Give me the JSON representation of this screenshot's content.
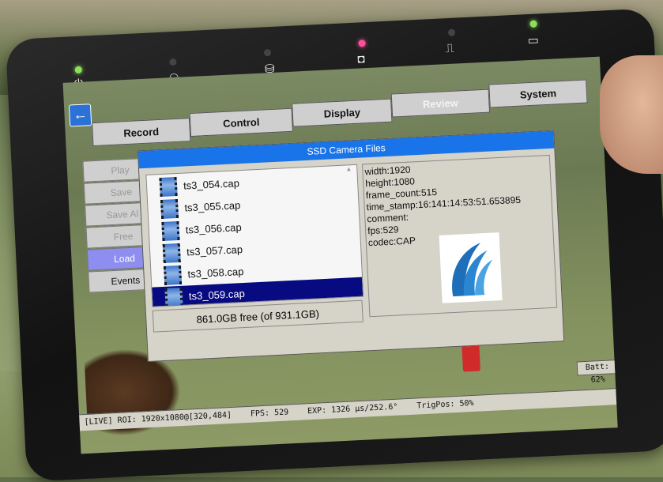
{
  "top_icons": {
    "power": "⏻",
    "network": "⚇",
    "storage": "⛁",
    "camera": "◘",
    "trigger": "⎍",
    "battery": "▭"
  },
  "tabs": [
    "Record",
    "Control",
    "Display",
    "Review",
    "System"
  ],
  "side_buttons": [
    "Play",
    "Save",
    "Save Al",
    "Free",
    "Load",
    "Events"
  ],
  "dialog": {
    "title": "SSD Camera Files",
    "files": [
      "ts3_054.cap",
      "ts3_055.cap",
      "ts3_056.cap",
      "ts3_057.cap",
      "ts3_058.cap",
      "ts3_059.cap"
    ],
    "selected_file": "ts3_059.cap",
    "free_space": "861.0GB free (of 931.1GB)",
    "info": [
      "width:1920",
      "height:1080",
      "frame_count:515",
      "time_stamp:16:141:14:53:51.653895",
      "comment:",
      "fps:529",
      "codec:CAP"
    ]
  },
  "battery": "Batt: 62%",
  "status": {
    "live": "[LIVE] ROI: 1920x1080@[320,484]",
    "fps": "FPS: 529",
    "exp": "EXP: 1326 µs/252.6°",
    "trig": "TrigPos: 50%"
  },
  "colors": {
    "accent": "#1874e8",
    "selected": "#070a80",
    "load_button": "#8e8ef0",
    "led_green": "#8de05a",
    "led_pink": "#ff4f9a"
  }
}
